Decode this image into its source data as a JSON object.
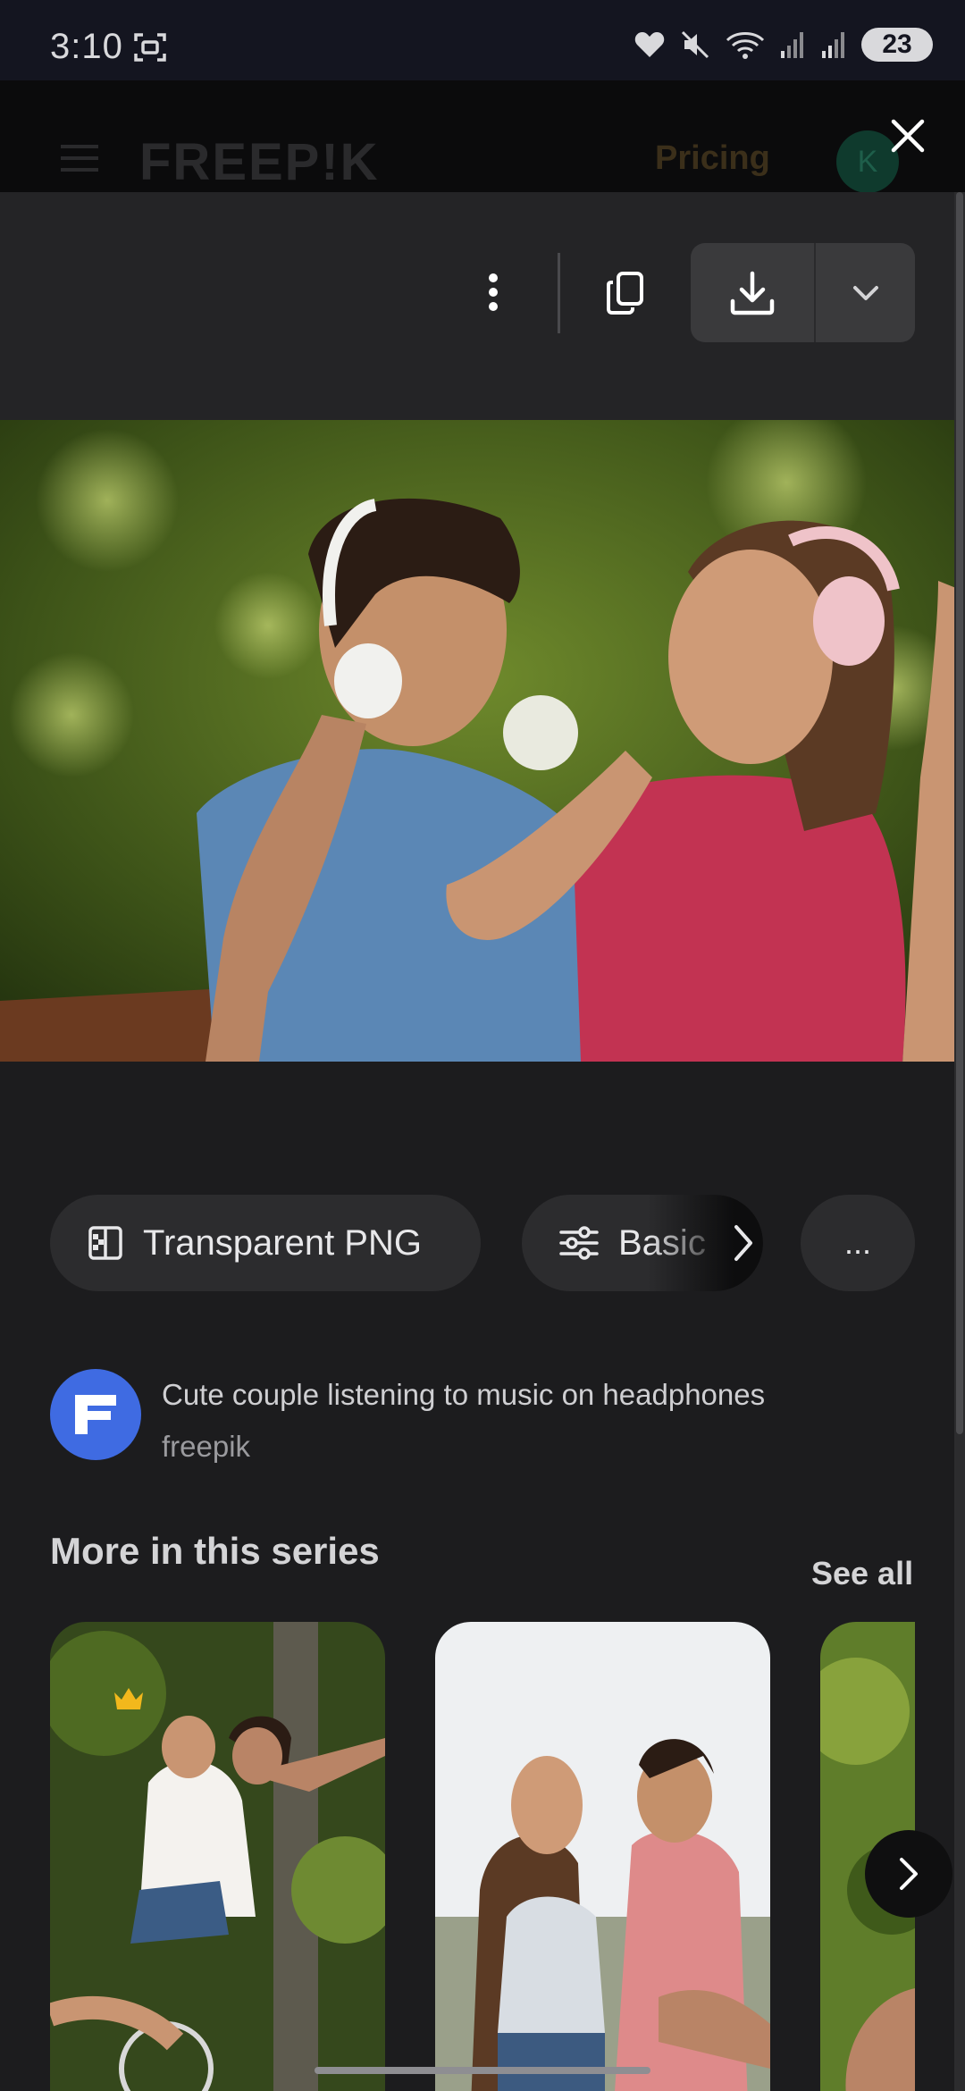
{
  "status_bar": {
    "time": "3:10",
    "battery": "23",
    "icons": [
      "screenshot-icon",
      "heart-icon",
      "mute-icon",
      "wifi-icon",
      "signal-icon",
      "signal-icon",
      "battery-icon"
    ]
  },
  "header": {
    "logo": "FREEP!K",
    "pricing": "Pricing",
    "avatar_initial": "K",
    "close_icon": "close-icon"
  },
  "toolbar": {
    "more_icon": "more-vert-icon",
    "copy_icon": "copy-icon",
    "download_icon": "download-icon",
    "dropdown_icon": "chevron-down-icon"
  },
  "chips": {
    "transparent_png": "Transparent PNG",
    "basic": "Basic",
    "more": "..."
  },
  "asset": {
    "title": "Cute couple listening to music on headphones",
    "author": "freepik"
  },
  "series": {
    "heading": "More in this series",
    "see_all": "See all"
  },
  "colors": {
    "background": "#1c1c1e",
    "chip_bg": "#2c2c2e",
    "author_avatar": "#3f6be2",
    "crown": "#f2b81c"
  }
}
